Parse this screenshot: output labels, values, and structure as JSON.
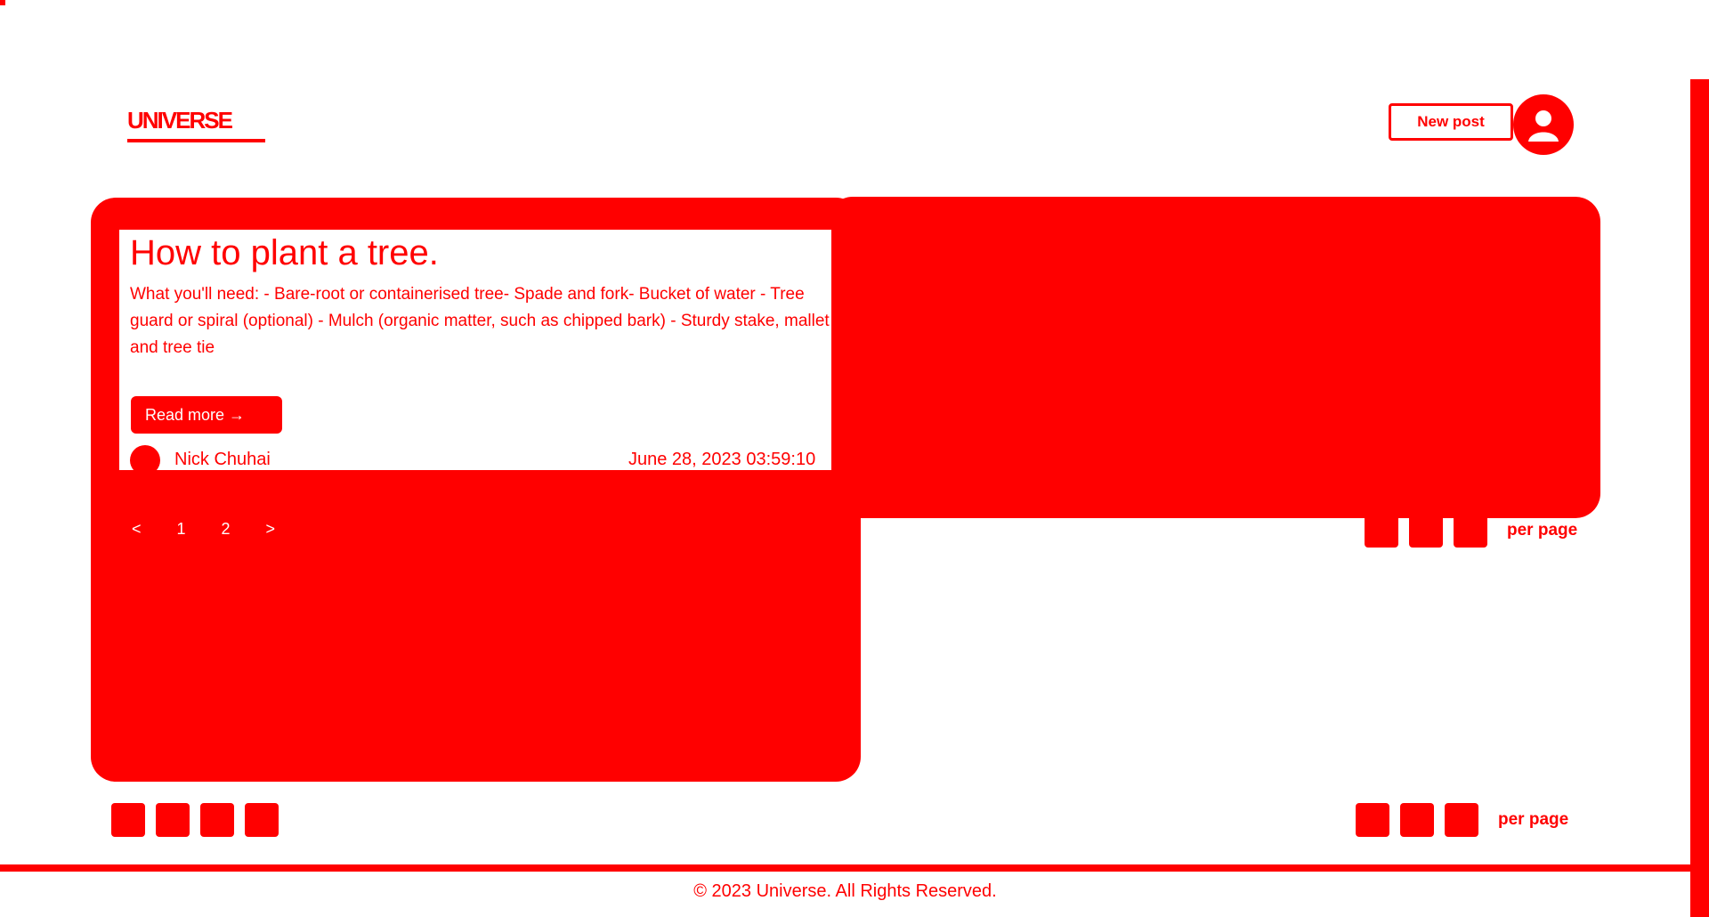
{
  "header": {
    "logo_text": "UNIVERSE",
    "new_post_label": "New post"
  },
  "post": {
    "title": "How to plant a tree.",
    "body": "What you'll need: - Bare-root or containerised tree- Spade and fork- Bucket of water - Tree guard or spiral (optional) - Mulch (organic matter, such as chipped bark) - Sturdy stake, mallet and tree tie",
    "read_more_label": "Read more →",
    "author": "Nick Chuhai",
    "date": "June 28, 2023 03:59:10"
  },
  "pagination": {
    "prev": "<",
    "pages": [
      "1",
      "2"
    ],
    "next": ">",
    "per_page_label": "per page"
  },
  "footer": {
    "copyright": "© 2023 Universe. All Rights Reserved."
  },
  "colors": {
    "accent": "#ff0000",
    "background": "#ffffff"
  }
}
